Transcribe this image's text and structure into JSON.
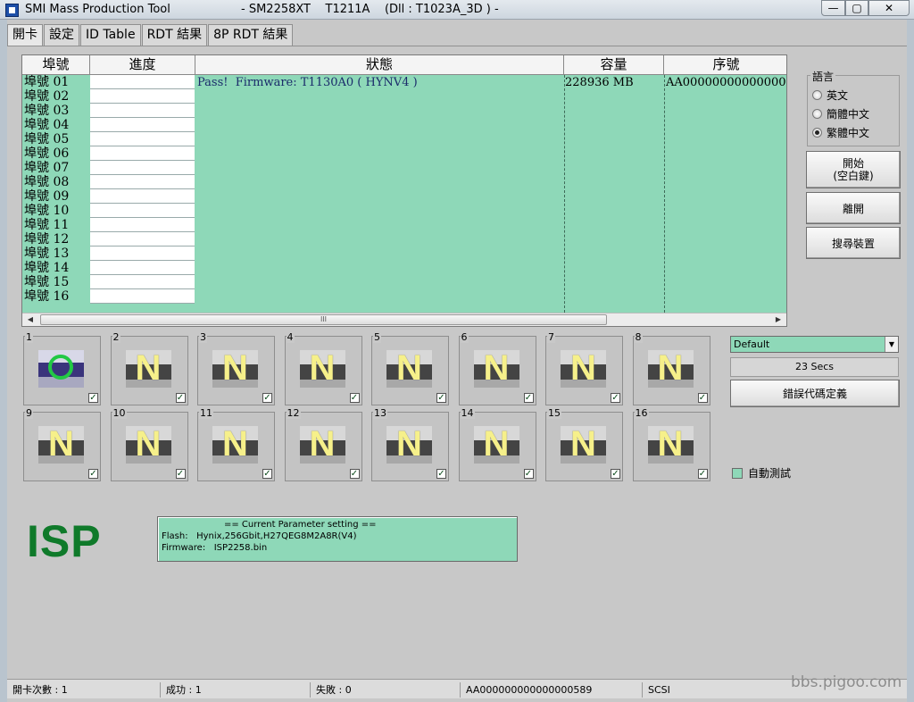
{
  "titlebar": {
    "app_title": "SMI Mass Production Tool",
    "subtitle": "- SM2258XT    T1211A    (Dll : T1023A_3D ) -",
    "minimize": "—",
    "maximize": "▢",
    "close": "✕"
  },
  "tabs": [
    "開卡",
    "設定",
    "ID Table",
    "RDT 結果",
    "8P RDT 結果"
  ],
  "grid": {
    "headers": [
      "埠號",
      "進度",
      "狀態",
      "容量",
      "序號"
    ],
    "ports": [
      "埠號 01",
      "埠號 02",
      "埠號 03",
      "埠號 04",
      "埠號 05",
      "埠號 06",
      "埠號 07",
      "埠號 08",
      "埠號 09",
      "埠號 10",
      "埠號 11",
      "埠號 12",
      "埠號 13",
      "埠號 14",
      "埠號 15",
      "埠號 16"
    ],
    "row1": {
      "status": "Pass!  Firmware: T1130A0 ( HYNV4 )",
      "capacity": "228936 MB",
      "serial": "AA00000000000000"
    },
    "scroll_thumb": "III",
    "scroll_left": "◀",
    "scroll_right": "▶"
  },
  "language": {
    "title": "語言",
    "options": [
      "英文",
      "簡體中文",
      "繁體中文"
    ],
    "selected": "繁體中文"
  },
  "buttons": {
    "start_line1": "開始",
    "start_line2": "(空白鍵)",
    "leave": "離開",
    "search": "搜尋裝置",
    "error_code": "錯誤代碼定義"
  },
  "profile_dropdown": {
    "value": "Default",
    "arrow": "▼"
  },
  "timer": "23 Secs",
  "auto_test": "自動測試",
  "port_tiles": [
    {
      "num": "1",
      "state": "O",
      "checked": true
    },
    {
      "num": "2",
      "state": "N",
      "checked": true
    },
    {
      "num": "3",
      "state": "N",
      "checked": true
    },
    {
      "num": "4",
      "state": "N",
      "checked": true
    },
    {
      "num": "5",
      "state": "N",
      "checked": true
    },
    {
      "num": "6",
      "state": "N",
      "checked": true
    },
    {
      "num": "7",
      "state": "N",
      "checked": true
    },
    {
      "num": "8",
      "state": "N",
      "checked": true
    },
    {
      "num": "9",
      "state": "N",
      "checked": true
    },
    {
      "num": "10",
      "state": "N",
      "checked": true
    },
    {
      "num": "11",
      "state": "N",
      "checked": true
    },
    {
      "num": "12",
      "state": "N",
      "checked": true
    },
    {
      "num": "13",
      "state": "N",
      "checked": true
    },
    {
      "num": "14",
      "state": "N",
      "checked": true
    },
    {
      "num": "15",
      "state": "N",
      "checked": true
    },
    {
      "num": "16",
      "state": "N",
      "checked": true
    }
  ],
  "check_glyph": "✓",
  "isp_label": "ISP",
  "parameters": {
    "title": "== Current Parameter setting ==",
    "flash": "Flash:   Hynix,256Gbit,H27QEG8M2A8R(V4)",
    "firmware": "Firmware:   ISP2258.bin"
  },
  "statusbar": {
    "open_count": "開卡次數 : 1",
    "success": "成功 : 1",
    "fail": "失敗 : 0",
    "serial": "AA000000000000000589",
    "interface": "SCSI"
  },
  "watermark": "bbs.pigoo.com",
  "colors": {
    "grid_green": "#8ed8b8",
    "isp_green": "#0f7a2a",
    "tile_yellow": "#f6f08a"
  }
}
